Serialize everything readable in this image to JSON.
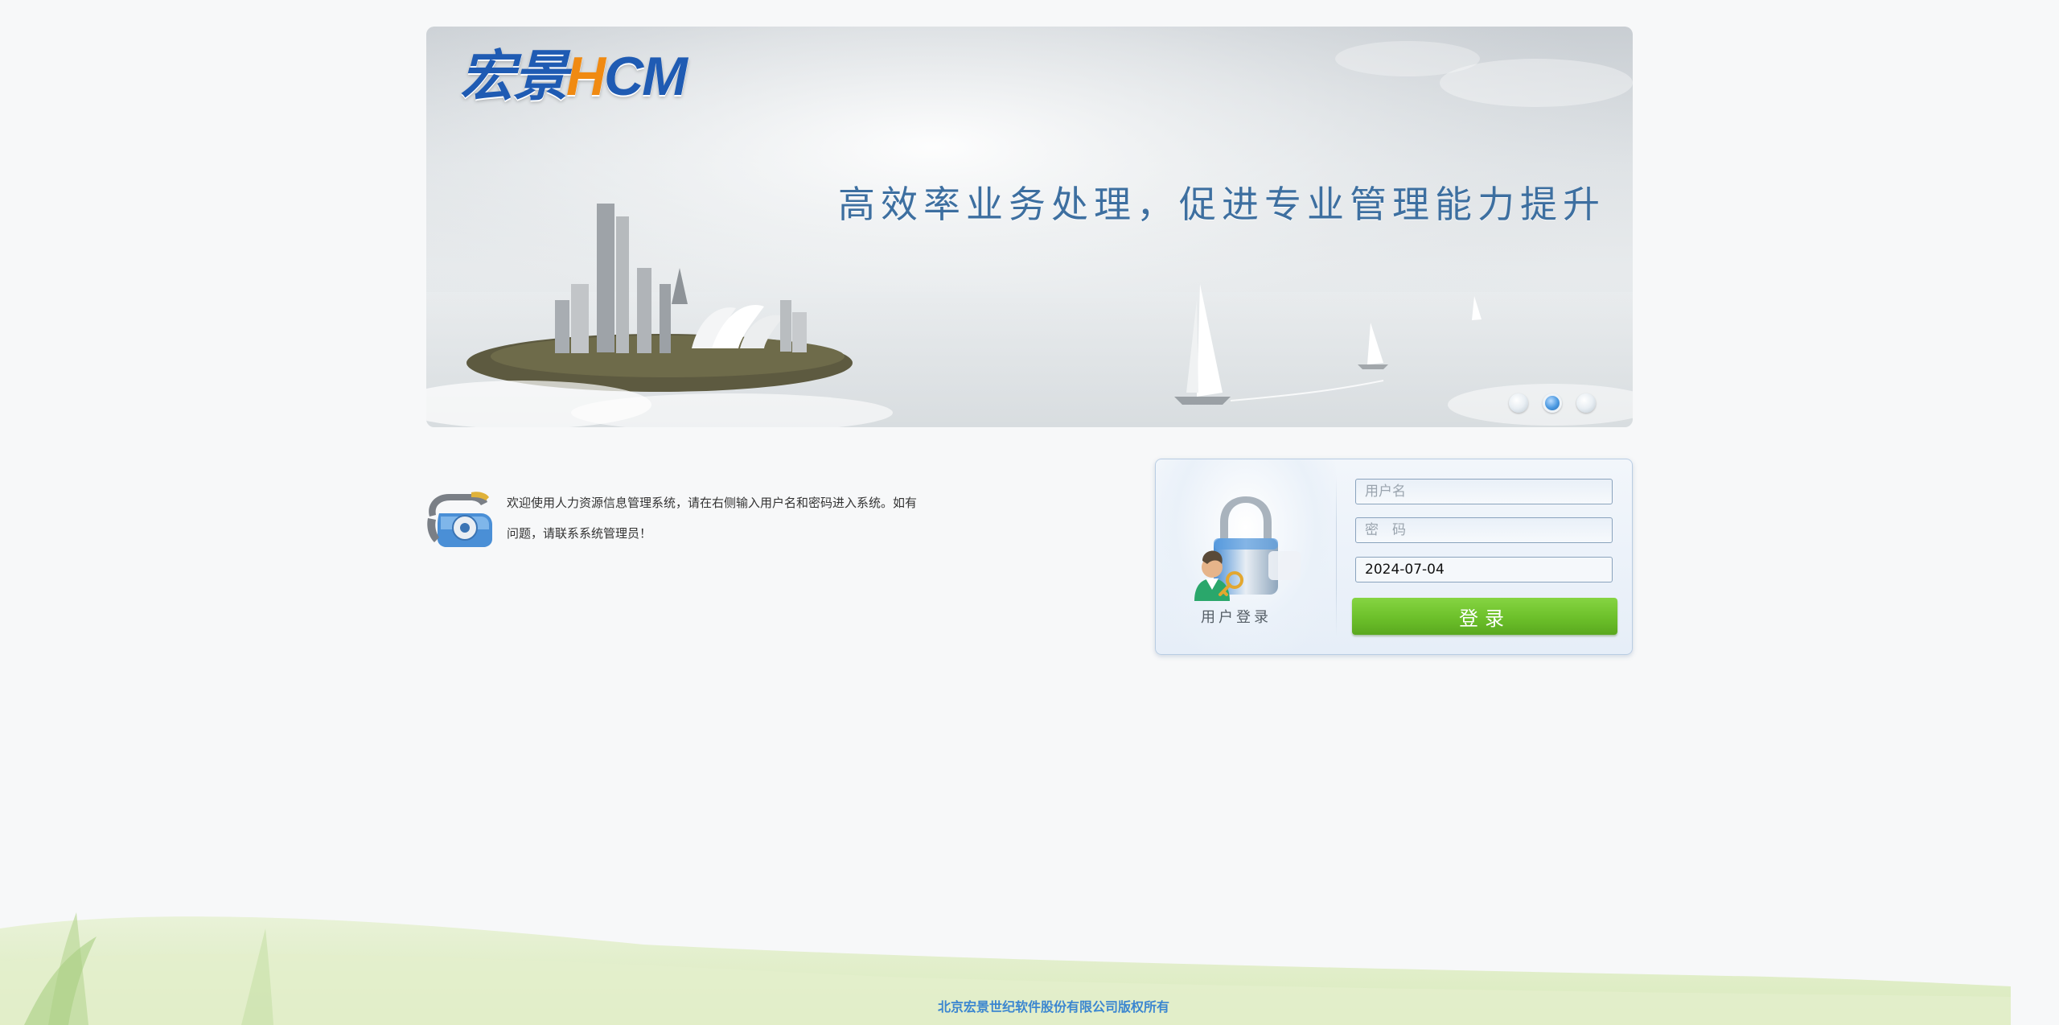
{
  "banner": {
    "logo_cn": "宏景",
    "logo_h": "H",
    "logo_cm": "CM",
    "slogan": "高效率业务处理，促进专业管理能力提升",
    "carousel": {
      "slide_count": 3,
      "active_index": 1
    }
  },
  "welcome": {
    "text": "欢迎使用人力资源信息管理系统，请在右侧输入用户名和密码进入系统。如有问题，请联系系统管理员！",
    "icon": "phone-icon"
  },
  "login": {
    "caption": "用户登录",
    "icon": "lock-user-icon",
    "username_placeholder": "用户名",
    "password_placeholder": "密　码",
    "date_value": "2024-07-04",
    "submit_label": "登录"
  },
  "footer": {
    "copyright": "北京宏景世纪软件股份有限公司版权所有"
  },
  "colors": {
    "accent_blue": "#3b86d0",
    "login_green": "#6cc02a",
    "logo_orange": "#f08a12",
    "logo_blue": "#1f5bb3"
  }
}
